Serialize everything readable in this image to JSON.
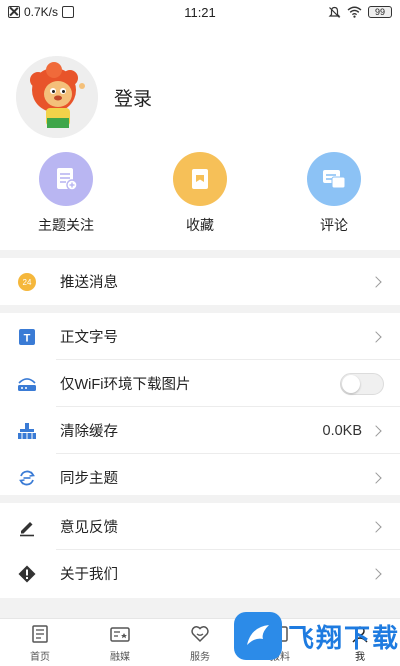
{
  "status_bar": {
    "network_speed": "0.7K/s",
    "time": "11:21",
    "battery": "99"
  },
  "profile": {
    "login_label": "登录"
  },
  "quick_actions": [
    {
      "label": "主题关注",
      "icon": "subject-follow-icon",
      "color": "#b9b6f2"
    },
    {
      "label": "收藏",
      "icon": "favorites-icon",
      "color": "#f6c058"
    },
    {
      "label": "评论",
      "icon": "comments-icon",
      "color": "#8cc2f5"
    }
  ],
  "menu_group1": [
    {
      "label": "推送消息",
      "icon": "push-message-icon"
    }
  ],
  "menu_group2": [
    {
      "label": "正文字号",
      "icon": "font-size-icon"
    },
    {
      "label": "仅WiFi环境下载图片",
      "icon": "wifi-download-icon"
    },
    {
      "label": "清除缓存",
      "icon": "clear-cache-icon",
      "value": "0.0KB"
    },
    {
      "label": "同步主题",
      "icon": "sync-subject-icon"
    }
  ],
  "menu_group3": [
    {
      "label": "意见反馈",
      "icon": "feedback-icon"
    },
    {
      "label": "关于我们",
      "icon": "about-us-icon"
    }
  ],
  "wifi_toggle": {
    "on": false
  },
  "tabs": [
    {
      "label": "首页",
      "icon": "home-icon"
    },
    {
      "label": "融媒",
      "icon": "media-icon"
    },
    {
      "label": "服务",
      "icon": "service-icon"
    },
    {
      "label": "报料",
      "icon": "report-icon"
    },
    {
      "label": "我",
      "icon": "me-icon",
      "active": true
    }
  ],
  "watermark": {
    "text": "飞翔下载"
  },
  "colors": {
    "accent_blue": "#1e7be0",
    "section_gap": "#f2f2f2",
    "badge_orange": "#f5b73b"
  }
}
